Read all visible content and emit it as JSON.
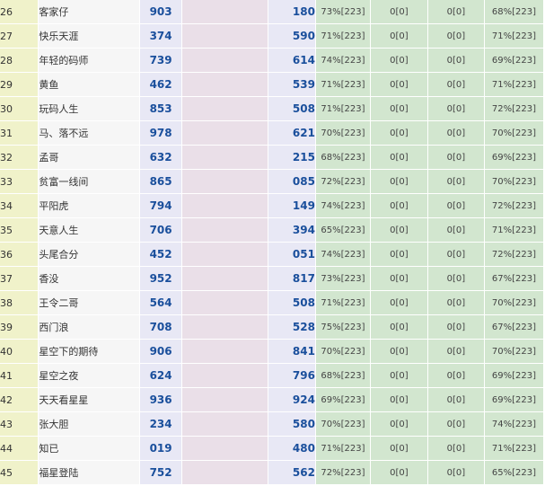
{
  "rows": [
    {
      "rank": "26",
      "name": "客家仔",
      "v1": "903",
      "v2": "180",
      "p1": "73%[223]",
      "p2": "0[0]",
      "p3": "0[0]",
      "p4": "68%[223]"
    },
    {
      "rank": "27",
      "name": "快乐天涯",
      "v1": "374",
      "v2": "590",
      "p1": "71%[223]",
      "p2": "0[0]",
      "p3": "0[0]",
      "p4": "71%[223]"
    },
    {
      "rank": "28",
      "name": "年轻的码师",
      "v1": "739",
      "v2": "614",
      "p1": "74%[223]",
      "p2": "0[0]",
      "p3": "0[0]",
      "p4": "69%[223]"
    },
    {
      "rank": "29",
      "name": "黄鱼",
      "v1": "462",
      "v2": "539",
      "p1": "71%[223]",
      "p2": "0[0]",
      "p3": "0[0]",
      "p4": "71%[223]"
    },
    {
      "rank": "30",
      "name": "玩码人生",
      "v1": "853",
      "v2": "508",
      "p1": "71%[223]",
      "p2": "0[0]",
      "p3": "0[0]",
      "p4": "72%[223]"
    },
    {
      "rank": "31",
      "name": "马、落不远",
      "v1": "978",
      "v2": "621",
      "p1": "70%[223]",
      "p2": "0[0]",
      "p3": "0[0]",
      "p4": "70%[223]"
    },
    {
      "rank": "32",
      "name": "孟哥",
      "v1": "632",
      "v2": "215",
      "p1": "68%[223]",
      "p2": "0[0]",
      "p3": "0[0]",
      "p4": "69%[223]"
    },
    {
      "rank": "33",
      "name": "贫富一线间",
      "v1": "865",
      "v2": "085",
      "p1": "72%[223]",
      "p2": "0[0]",
      "p3": "0[0]",
      "p4": "70%[223]"
    },
    {
      "rank": "34",
      "name": "平阳虎",
      "v1": "794",
      "v2": "149",
      "p1": "74%[223]",
      "p2": "0[0]",
      "p3": "0[0]",
      "p4": "72%[223]"
    },
    {
      "rank": "35",
      "name": "天意人生",
      "v1": "706",
      "v2": "394",
      "p1": "65%[223]",
      "p2": "0[0]",
      "p3": "0[0]",
      "p4": "71%[223]"
    },
    {
      "rank": "36",
      "name": "头尾合分",
      "v1": "452",
      "v2": "051",
      "p1": "74%[223]",
      "p2": "0[0]",
      "p3": "0[0]",
      "p4": "72%[223]"
    },
    {
      "rank": "37",
      "name": "香没",
      "v1": "952",
      "v2": "817",
      "p1": "73%[223]",
      "p2": "0[0]",
      "p3": "0[0]",
      "p4": "67%[223]"
    },
    {
      "rank": "38",
      "name": "王令二哥",
      "v1": "564",
      "v2": "508",
      "p1": "71%[223]",
      "p2": "0[0]",
      "p3": "0[0]",
      "p4": "70%[223]"
    },
    {
      "rank": "39",
      "name": "西门浪",
      "v1": "708",
      "v2": "528",
      "p1": "75%[223]",
      "p2": "0[0]",
      "p3": "0[0]",
      "p4": "67%[223]"
    },
    {
      "rank": "40",
      "name": "星空下的期待",
      "v1": "906",
      "v2": "841",
      "p1": "70%[223]",
      "p2": "0[0]",
      "p3": "0[0]",
      "p4": "70%[223]"
    },
    {
      "rank": "41",
      "name": "星空之夜",
      "v1": "624",
      "v2": "796",
      "p1": "68%[223]",
      "p2": "0[0]",
      "p3": "0[0]",
      "p4": "69%[223]"
    },
    {
      "rank": "42",
      "name": "天天看星星",
      "v1": "936",
      "v2": "924",
      "p1": "69%[223]",
      "p2": "0[0]",
      "p3": "0[0]",
      "p4": "69%[223]"
    },
    {
      "rank": "43",
      "name": "张大胆",
      "v1": "234",
      "v2": "580",
      "p1": "70%[223]",
      "p2": "0[0]",
      "p3": "0[0]",
      "p4": "74%[223]"
    },
    {
      "rank": "44",
      "name": "知已",
      "v1": "019",
      "v2": "480",
      "p1": "71%[223]",
      "p2": "0[0]",
      "p3": "0[0]",
      "p4": "71%[223]"
    },
    {
      "rank": "45",
      "name": "福星登陆",
      "v1": "752",
      "v2": "562",
      "p1": "72%[223]",
      "p2": "0[0]",
      "p3": "0[0]",
      "p4": "65%[223]"
    }
  ]
}
